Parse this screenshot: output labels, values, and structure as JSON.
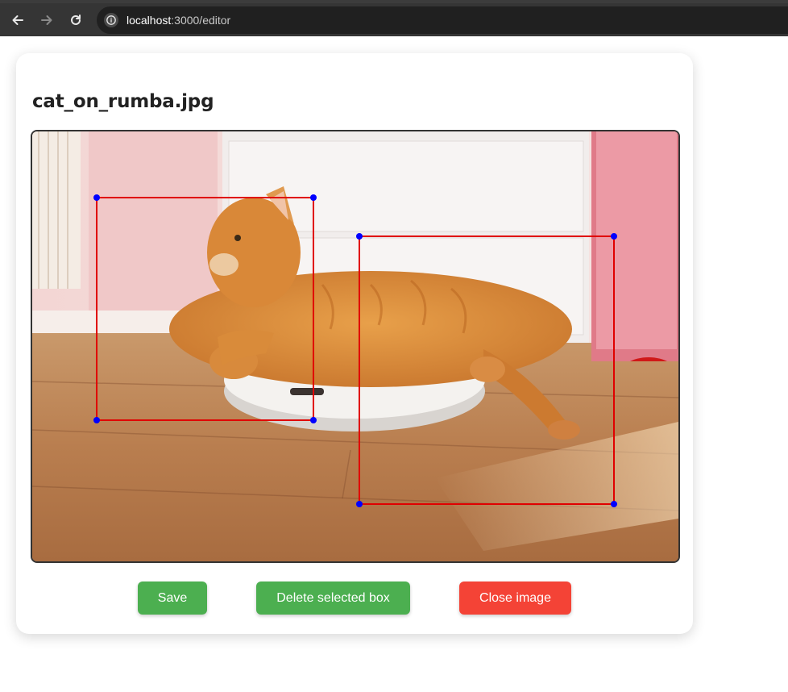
{
  "browser": {
    "url_host": "localhost",
    "url_path": ":3000/editor",
    "back_icon": "arrow-left-icon",
    "forward_icon": "arrow-right-icon",
    "reload_icon": "reload-icon",
    "info_icon": "info-icon"
  },
  "editor": {
    "filename": "cat_on_rumba.jpg",
    "box_color": "#e00000",
    "handle_color": "#0000ff"
  },
  "buttons": {
    "save": "Save",
    "delete": "Delete selected box",
    "close": "Close image"
  },
  "colors": {
    "save": "#4caf50",
    "delete": "#4caf50",
    "close": "#f44336"
  }
}
